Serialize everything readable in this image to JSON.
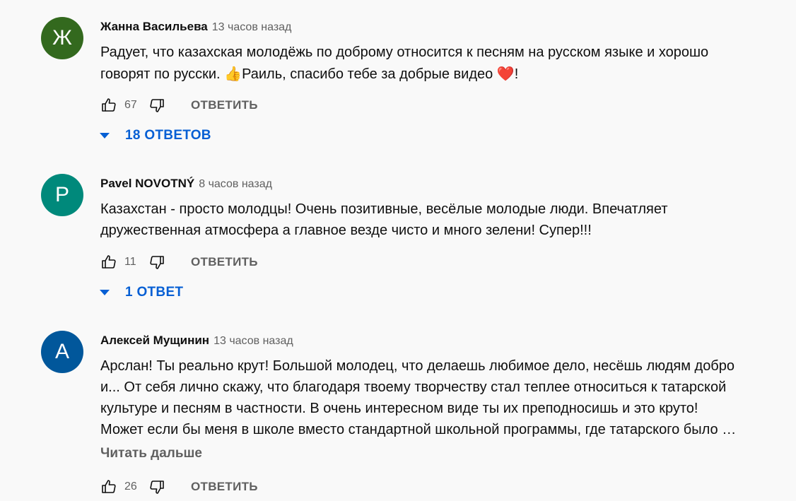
{
  "comments": [
    {
      "avatar_letter": "Ж",
      "avatar_color": "#33691e",
      "author": "Жанна Васильева",
      "time": "13 часов назад",
      "lines": [
        "Радует, что казахская молодёжь по доброму относится к песням на русском языке и  хорошо",
        "говорят по русски. ",
        "Раиль, спасибо тебе за добрые видео ",
        "!"
      ],
      "emoji_thumb": "👍",
      "emoji_heart": "❤️",
      "likes": "67",
      "reply_label": "ОТВЕТИТЬ",
      "replies_label": "18 ОТВЕТОВ"
    },
    {
      "avatar_letter": "P",
      "avatar_color": "#00897b",
      "author": "Pavel NOVOTNÝ",
      "time": "8 часов назад",
      "lines": [
        "Казахстан - просто молодцы! Очень позитивные, весёлые молодые люди. Впечатляет",
        "дружественная атмосфера а главное везде чисто и много зелени! Супер!!!"
      ],
      "likes": "11",
      "reply_label": "ОТВЕТИТЬ",
      "replies_label": "1 ОТВЕТ"
    },
    {
      "avatar_letter": "А",
      "avatar_color": "#01579b",
      "author": "Алексей Мущинин",
      "time": "13 часов назад",
      "lines": [
        "Арслан! Ты реально крут! Большой молодец, что делаешь любимое дело, несёшь людям добро",
        "и... От себя лично скажу, что благодаря твоему творчеству стал теплее относиться к татарской",
        "культуре и песням в частности. В очень интересном виде ты их преподносишь и это круто!",
        "Может если бы меня в школе вместо стандартной школьной программы, где татарского было …"
      ],
      "read_more": "Читать дальше",
      "likes": "26",
      "reply_label": "ОТВЕТИТЬ"
    }
  ],
  "icons": {
    "like": "thumb-up-icon",
    "dislike": "thumb-down-icon",
    "expand": "caret-down-icon"
  }
}
